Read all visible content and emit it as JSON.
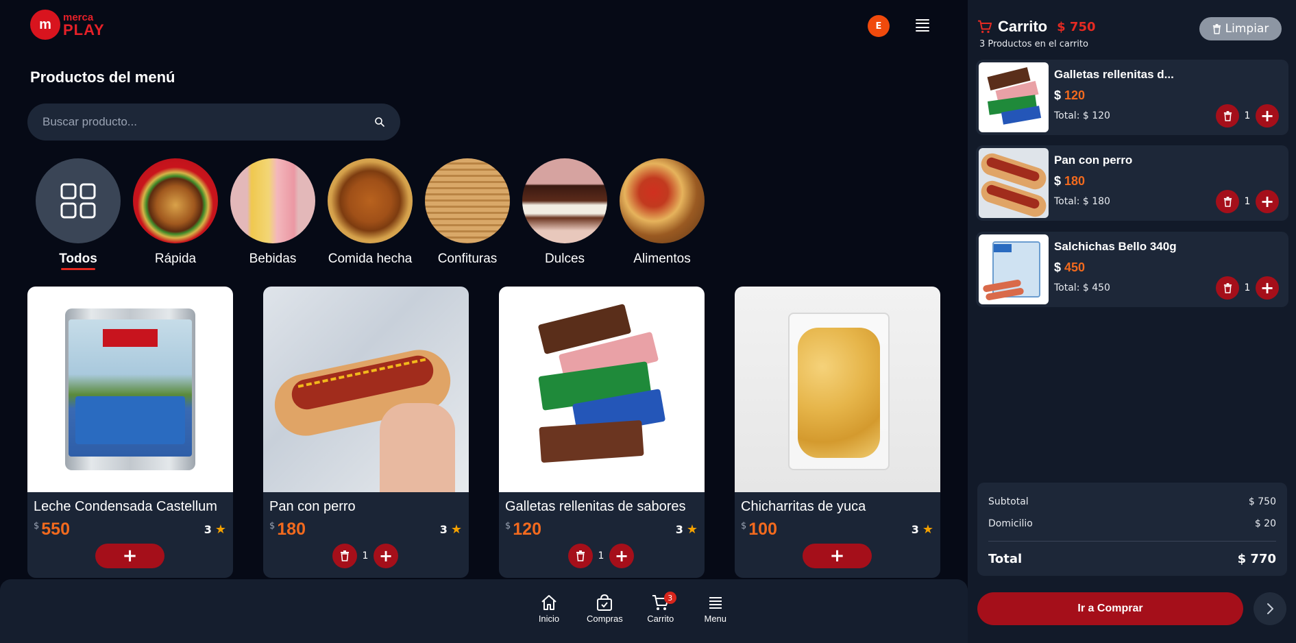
{
  "header": {
    "logo_mark": "m",
    "logo_top": "merca",
    "logo_bottom": "PLAY",
    "avatar_initial": "E"
  },
  "section_title": "Productos del menú",
  "search": {
    "placeholder": "Buscar producto...",
    "value": ""
  },
  "categories": [
    {
      "label": "Todos",
      "active": true
    },
    {
      "label": "Rápida"
    },
    {
      "label": "Bebidas"
    },
    {
      "label": "Comida hecha"
    },
    {
      "label": "Confituras"
    },
    {
      "label": "Dulces"
    },
    {
      "label": "Alimentos"
    }
  ],
  "products": [
    {
      "name": "Leche Condensada Castellum",
      "currency": "$",
      "price": "550",
      "rating": "3",
      "in_cart": false
    },
    {
      "name": "Pan con perro",
      "currency": "$",
      "price": "180",
      "rating": "3",
      "in_cart": true,
      "qty": "1"
    },
    {
      "name": "Galletas rellenitas de sabores",
      "currency": "$",
      "price": "120",
      "rating": "3",
      "in_cart": true,
      "qty": "1"
    },
    {
      "name": "Chicharritas de yuca",
      "currency": "$",
      "price": "100",
      "rating": "3",
      "in_cart": false
    }
  ],
  "nav": [
    {
      "label": "Inicio",
      "icon": "home-icon"
    },
    {
      "label": "Compras",
      "icon": "shopping-bag-icon"
    },
    {
      "label": "Carrito",
      "icon": "cart-icon",
      "badge": "3"
    },
    {
      "label": "Menu",
      "icon": "menu-icon"
    }
  ],
  "cart": {
    "title": "Carrito",
    "total_top": "$ 750",
    "subtitle": "3 Productos en el carrito",
    "clear_label": "Limpiar",
    "items": [
      {
        "name": "Galletas rellenitas d...",
        "currency": "$",
        "price": "120",
        "total": "Total: $ 120",
        "qty": "1"
      },
      {
        "name": "Pan con perro",
        "currency": "$",
        "price": "180",
        "total": "Total: $ 180",
        "qty": "1"
      },
      {
        "name": "Salchichas Bello 340g",
        "currency": "$",
        "price": "450",
        "total": "Total: $ 450",
        "qty": "1"
      }
    ],
    "summary": {
      "subtotal_label": "Subtotal",
      "subtotal_value": "$ 750",
      "delivery_label": "Domicilio",
      "delivery_value": "$ 20",
      "total_label": "Total",
      "total_value": "$ 770"
    },
    "buy_label": "Ir a Comprar"
  },
  "colors": {
    "accent": "#a50f1a",
    "price": "#f26a1e",
    "brand": "#e52028",
    "star": "#f4a100"
  }
}
